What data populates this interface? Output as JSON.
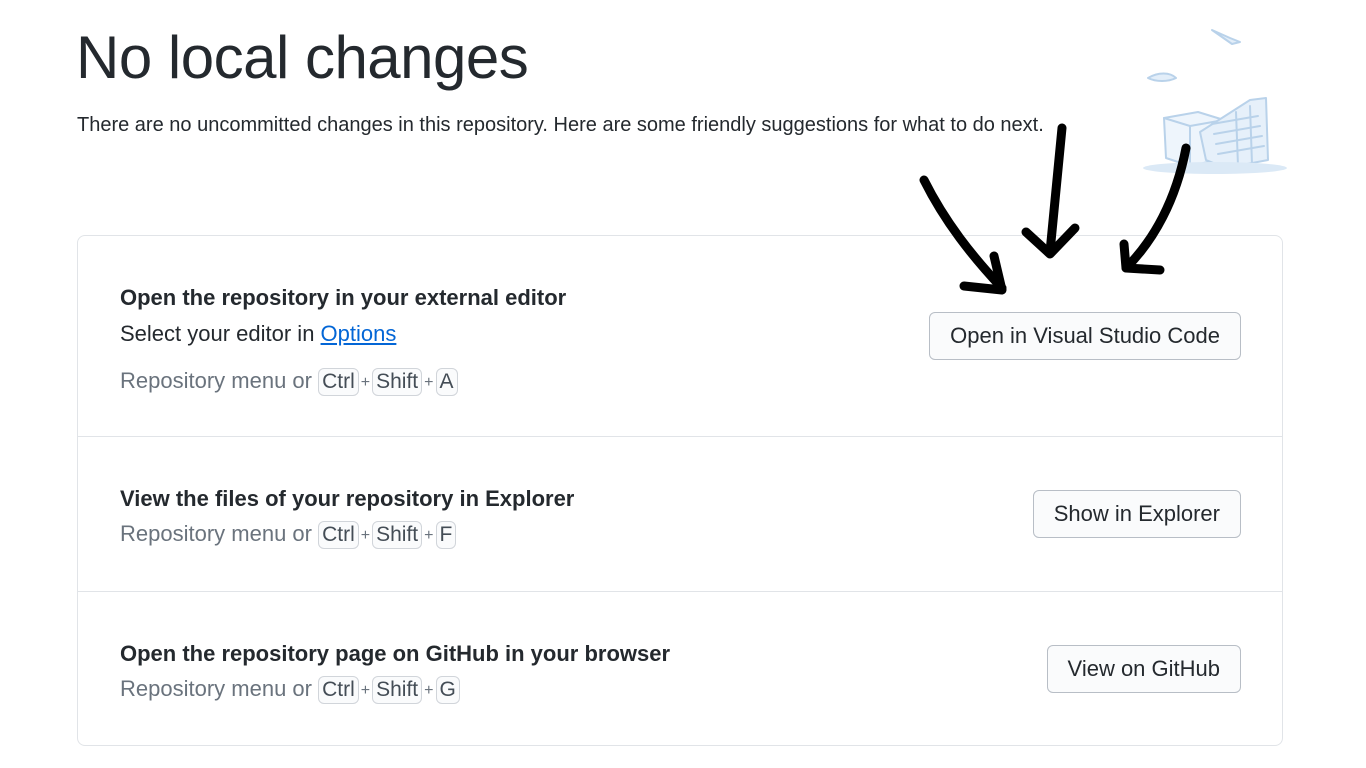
{
  "page": {
    "title": "No local changes",
    "subtitle": "There are no uncommitted changes in this repository. Here are some friendly suggestions for what to do next."
  },
  "suggestions": [
    {
      "title": "Open the repository in your external editor",
      "description_prefix": "Select your editor in ",
      "description_link": "Options",
      "shortcut_prefix": "Repository menu or",
      "keys": [
        "Ctrl",
        "Shift",
        "A"
      ],
      "button_label": "Open in Visual Studio Code"
    },
    {
      "title": "View the files of your repository in Explorer",
      "shortcut_prefix": "Repository menu or",
      "keys": [
        "Ctrl",
        "Shift",
        "F"
      ],
      "button_label": "Show in Explorer"
    },
    {
      "title": "Open the repository page on GitHub in your browser",
      "shortcut_prefix": "Repository menu or",
      "keys": [
        "Ctrl",
        "Shift",
        "G"
      ],
      "button_label": "View on GitHub"
    }
  ],
  "shortcut_separator": "+",
  "colors": {
    "link": "#0366d6",
    "border": "#e1e4e8",
    "muted_text": "#6a737d",
    "illustration": "#c8dcf0",
    "annotation_arrows": "#000000"
  },
  "icons": {
    "illustration": "empty-state-illustration",
    "annotation": "hand-drawn-arrows"
  }
}
